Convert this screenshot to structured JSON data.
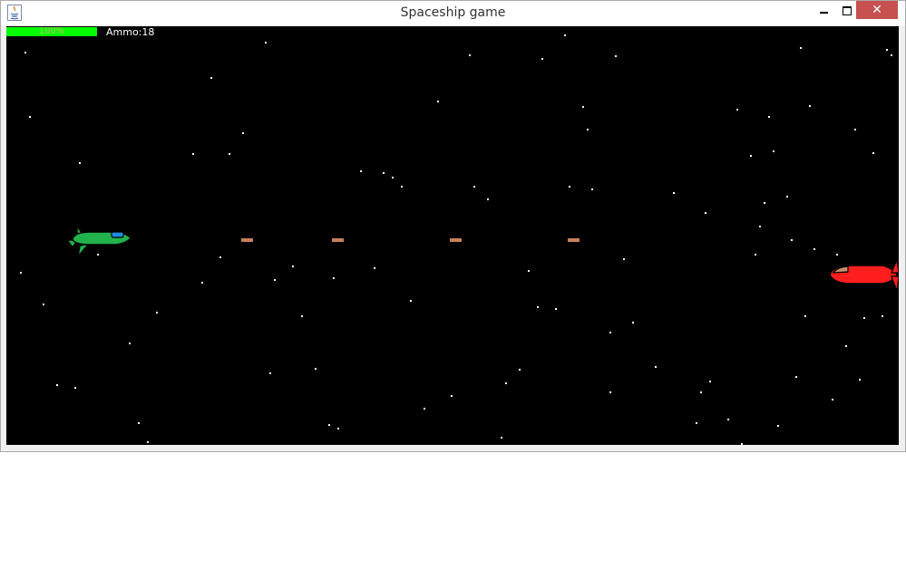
{
  "window": {
    "title": "Spaceship game",
    "close_label": "✕"
  },
  "hud": {
    "health_text": "100%",
    "health_fraction": 1.0,
    "ammo_text": "Ammo:18"
  },
  "colors": {
    "health": "#00ff00",
    "player": "#22b24c",
    "enemy": "#ff1e1e",
    "bullet": "#c8805a",
    "background": "#000000"
  },
  "player_ship": {
    "icon": "green-spaceship-icon"
  },
  "enemy_ship": {
    "icon": "red-spaceship-icon"
  }
}
